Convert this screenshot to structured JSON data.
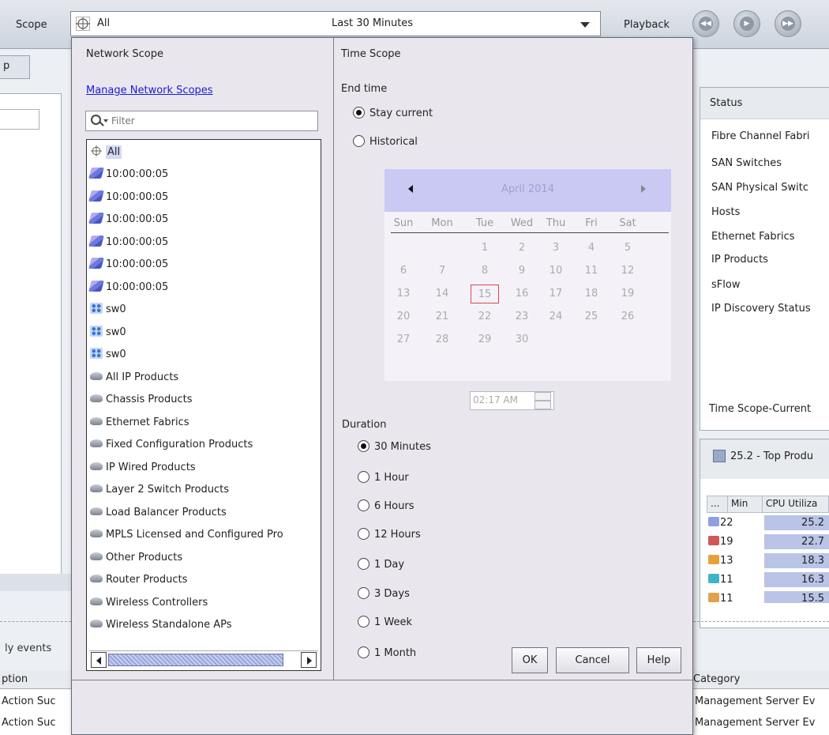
{
  "toolbar": {
    "scope_label": "Scope",
    "scope_value": "All",
    "time_value": "Last 30 Minutes",
    "playback_label": "Playback"
  },
  "background": {
    "tab_label": "p",
    "events_label": "ly events",
    "left_table_header": "ption",
    "left_table_rows": [
      "Action Suc",
      "Action Suc"
    ],
    "status_header": "Status",
    "status_items": [
      "Fibre Channel Fabri",
      "SAN Switches",
      "SAN Physical Switc",
      "Hosts",
      "Ethernet Fabrics",
      "IP Products",
      "sFlow",
      "IP Discovery Status"
    ],
    "time_scope_current": "Time Scope-Current",
    "top_panel_title": "25.2 - Top Produ",
    "top_columns": [
      "...",
      "Min",
      "CPU Utiliza"
    ],
    "top_rows": [
      {
        "min": "22",
        "cpu": "25.2"
      },
      {
        "min": "19",
        "cpu": "22.7"
      },
      {
        "min": "13",
        "cpu": "18.3"
      },
      {
        "min": "11",
        "cpu": "16.3"
      },
      {
        "min": "11",
        "cpu": "15.5"
      }
    ],
    "right_table_header": "Category",
    "right_table_rows": [
      "Management Server Ev",
      "Management Server Ev"
    ]
  },
  "network_scope": {
    "title": "Network Scope",
    "manage_link": "Manage Network Scopes",
    "filter_placeholder": "Filter",
    "items": [
      {
        "label": "All",
        "icon": "all-scope-icon",
        "selected": true
      },
      {
        "label": "10:00:00:05",
        "icon": "fabric-icon"
      },
      {
        "label": "10:00:00:05",
        "icon": "fabric-icon"
      },
      {
        "label": "10:00:00:05",
        "icon": "fabric-icon"
      },
      {
        "label": "10:00:00:05",
        "icon": "fabric-icon"
      },
      {
        "label": "10:00:00:05",
        "icon": "fabric-icon"
      },
      {
        "label": "10:00:00:05",
        "icon": "fabric-icon"
      },
      {
        "label": "sw0",
        "icon": "switch-icon"
      },
      {
        "label": "sw0",
        "icon": "switch-icon"
      },
      {
        "label": "sw0",
        "icon": "switch-icon"
      },
      {
        "label": "All IP Products",
        "icon": "ip-product-icon"
      },
      {
        "label": "Chassis Products",
        "icon": "ip-product-icon"
      },
      {
        "label": "Ethernet Fabrics",
        "icon": "ip-product-icon"
      },
      {
        "label": "Fixed Configuration Products",
        "icon": "ip-product-icon"
      },
      {
        "label": "IP Wired Products",
        "icon": "ip-product-icon"
      },
      {
        "label": "Layer 2 Switch Products",
        "icon": "ip-product-icon"
      },
      {
        "label": "Load Balancer Products",
        "icon": "ip-product-icon"
      },
      {
        "label": "MPLS Licensed and Configured Pro",
        "icon": "ip-product-icon"
      },
      {
        "label": "Other Products",
        "icon": "ip-product-icon"
      },
      {
        "label": "Router Products",
        "icon": "ip-product-icon"
      },
      {
        "label": "Wireless Controllers",
        "icon": "ip-product-icon"
      },
      {
        "label": "Wireless Standalone APs",
        "icon": "ip-product-icon"
      }
    ]
  },
  "time_scope": {
    "title": "Time Scope",
    "end_time_label": "End time",
    "end_time_options": [
      {
        "label": "Stay current",
        "checked": true
      },
      {
        "label": "Historical",
        "checked": false
      }
    ],
    "calendar": {
      "month": "April 2014",
      "days_of_week": [
        "Sun",
        "Mon",
        "Tue",
        "Wed",
        "Thu",
        "Fri",
        "Sat"
      ],
      "weeks": [
        [
          "",
          "",
          "1",
          "2",
          "3",
          "4",
          "5"
        ],
        [
          "6",
          "7",
          "8",
          "9",
          "10",
          "11",
          "12"
        ],
        [
          "13",
          "14",
          "15",
          "16",
          "17",
          "18",
          "19"
        ],
        [
          "20",
          "21",
          "22",
          "23",
          "24",
          "25",
          "26"
        ],
        [
          "27",
          "28",
          "29",
          "30",
          "",
          "",
          ""
        ]
      ],
      "today": "15"
    },
    "time_value": "02:17 AM",
    "duration_label": "Duration",
    "duration_options": [
      {
        "label": "30 Minutes",
        "checked": true
      },
      {
        "label": "1 Hour",
        "checked": false
      },
      {
        "label": "6 Hours",
        "checked": false
      },
      {
        "label": "12 Hours",
        "checked": false
      },
      {
        "label": "1 Day",
        "checked": false
      },
      {
        "label": "3 Days",
        "checked": false
      },
      {
        "label": "1 Week",
        "checked": false
      },
      {
        "label": "1 Month",
        "checked": false
      }
    ]
  },
  "buttons": {
    "ok": "OK",
    "cancel": "Cancel",
    "help": "Help"
  }
}
